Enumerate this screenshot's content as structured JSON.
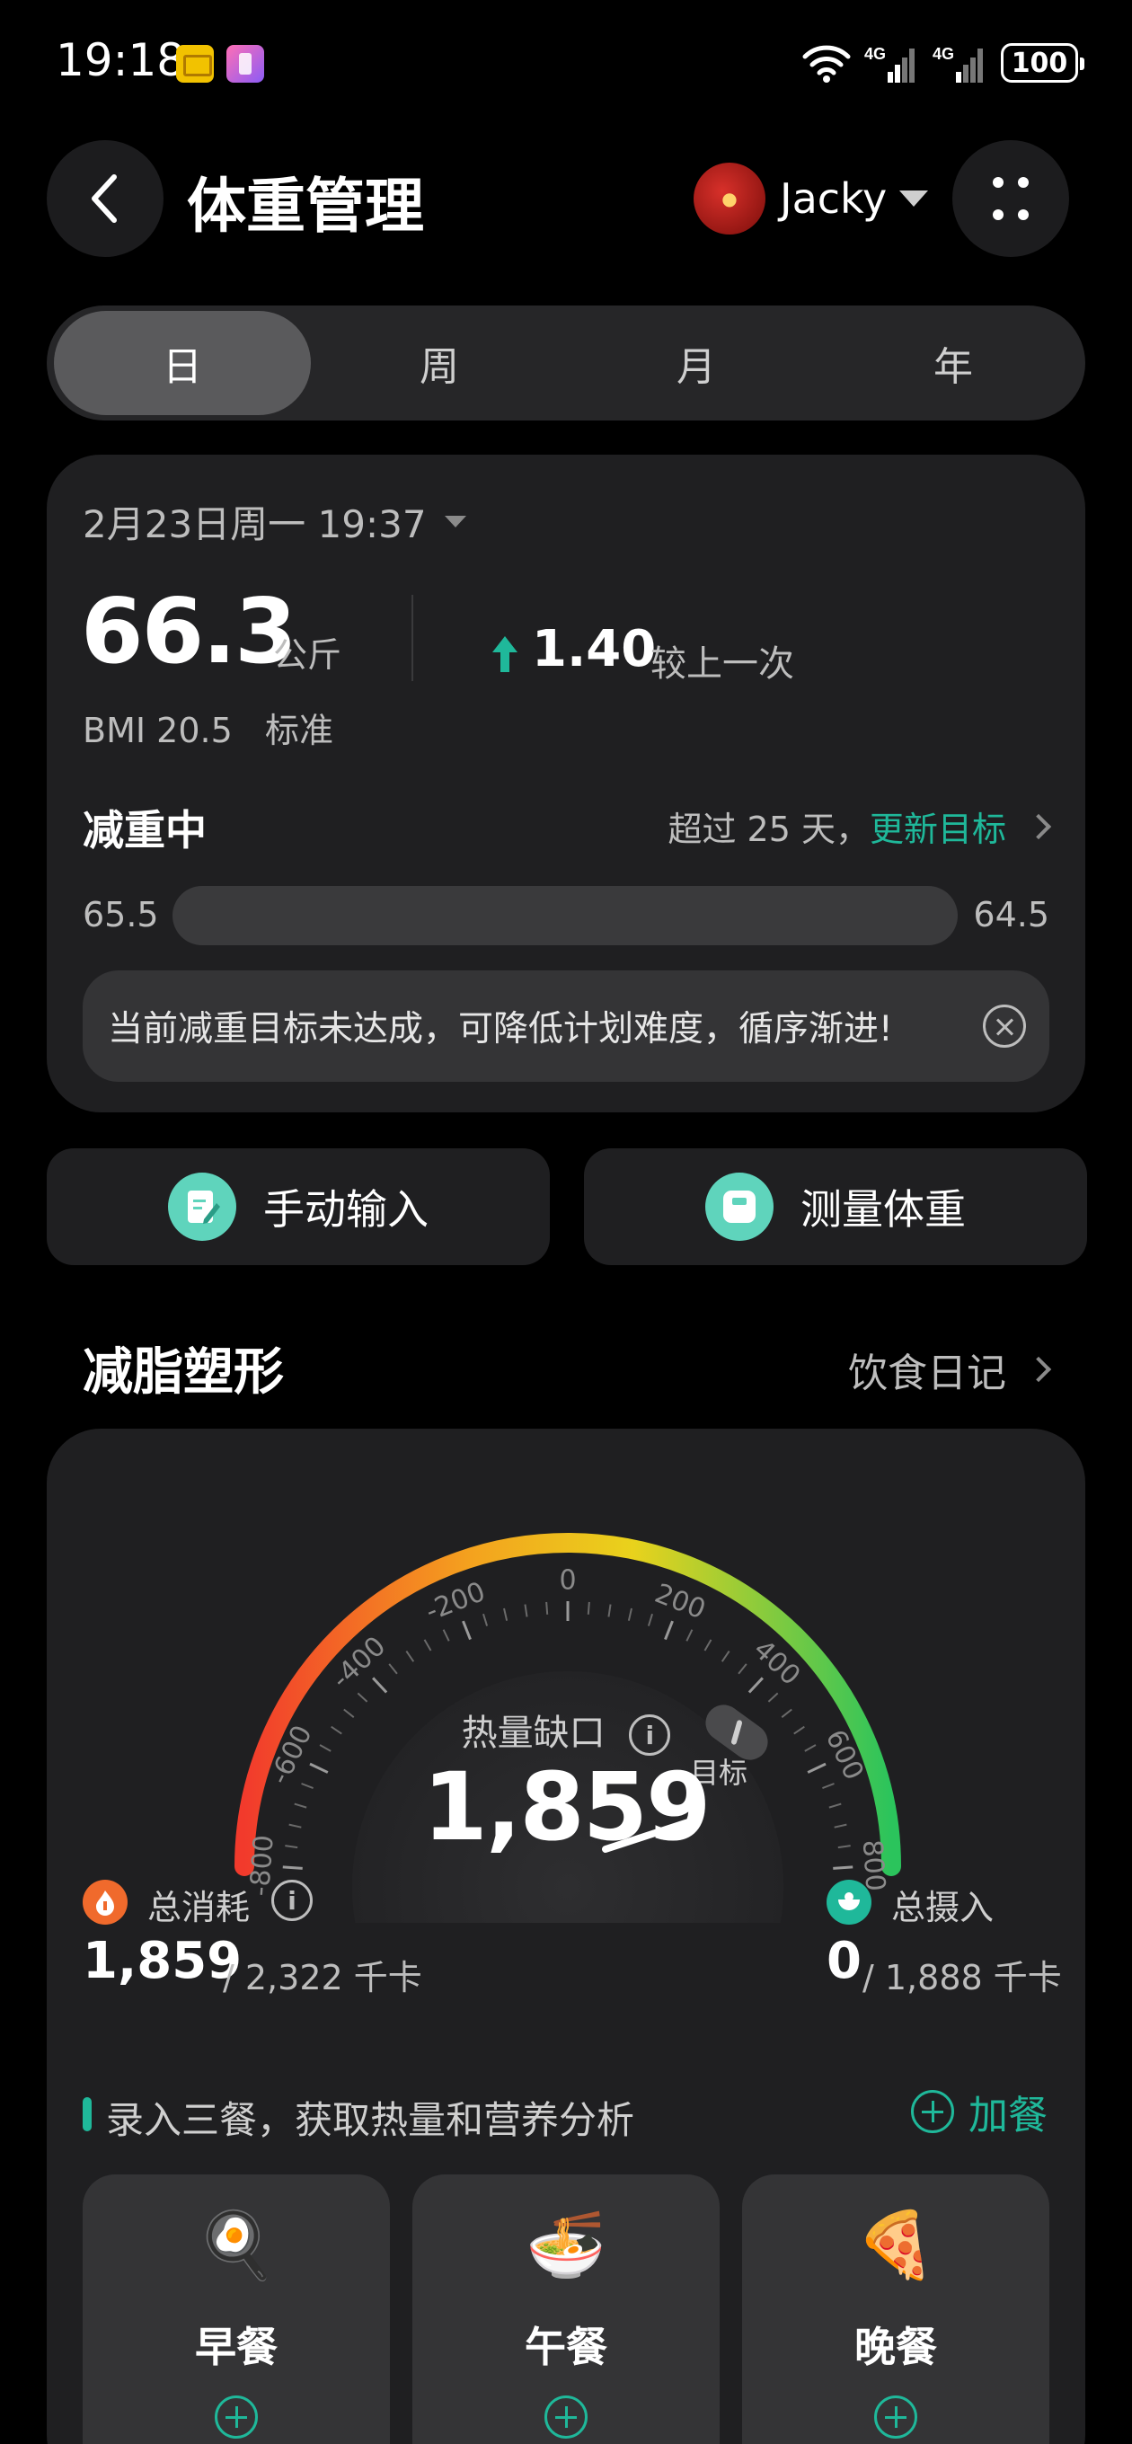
{
  "status_bar": {
    "time": "19:18",
    "signal_1": "4G",
    "signal_2": "4G",
    "battery": "100"
  },
  "header": {
    "title": "体重管理",
    "user_name": "Jacky"
  },
  "tabs": [
    {
      "label": "日",
      "active": true
    },
    {
      "label": "周",
      "active": false
    },
    {
      "label": "月",
      "active": false
    },
    {
      "label": "年",
      "active": false
    }
  ],
  "weight_card": {
    "datetime": "2月23日周一 19:37",
    "weight": "66.3",
    "unit": "公斤",
    "delta": "1.40",
    "delta_label": "较上一次",
    "bmi": "BMI 20.5",
    "bmi_status": "标准",
    "status": "减重中",
    "goal_days": "超过 25 天，",
    "goal_link": "更新目标",
    "range_start": "65.5",
    "range_end": "64.5",
    "progress": 0,
    "tip": "当前减重目标未达成，可降低计划难度，循序渐进!"
  },
  "actions": {
    "manual": "手动输入",
    "measure": "测量体重"
  },
  "section": {
    "title": "减脂塑形",
    "diary": "饮食日记"
  },
  "gauge": {
    "label": "热量缺口",
    "value": "1,859",
    "ticks": [
      "-800",
      "-600",
      "-400",
      "-200",
      "0",
      "200",
      "400",
      "600",
      "800"
    ],
    "target_label": "目标",
    "colors": [
      "#f23a2c",
      "#f4a21e",
      "#e9d21c",
      "#2bc45c"
    ]
  },
  "stats": {
    "burn_label": "总消耗",
    "burn_value": "1,859",
    "burn_total": "/ 2,322 千卡",
    "intake_label": "总摄入",
    "intake_value": "0",
    "intake_total": "/ 1,888 千卡"
  },
  "meals": {
    "hint": "录入三餐，获取热量和营养分析",
    "add": "加餐",
    "items": [
      {
        "label": "早餐",
        "emoji": "🍳"
      },
      {
        "label": "午餐",
        "emoji": "🍜"
      },
      {
        "label": "晚餐",
        "emoji": "🍕"
      }
    ]
  },
  "accent_color": "#1fb89a"
}
